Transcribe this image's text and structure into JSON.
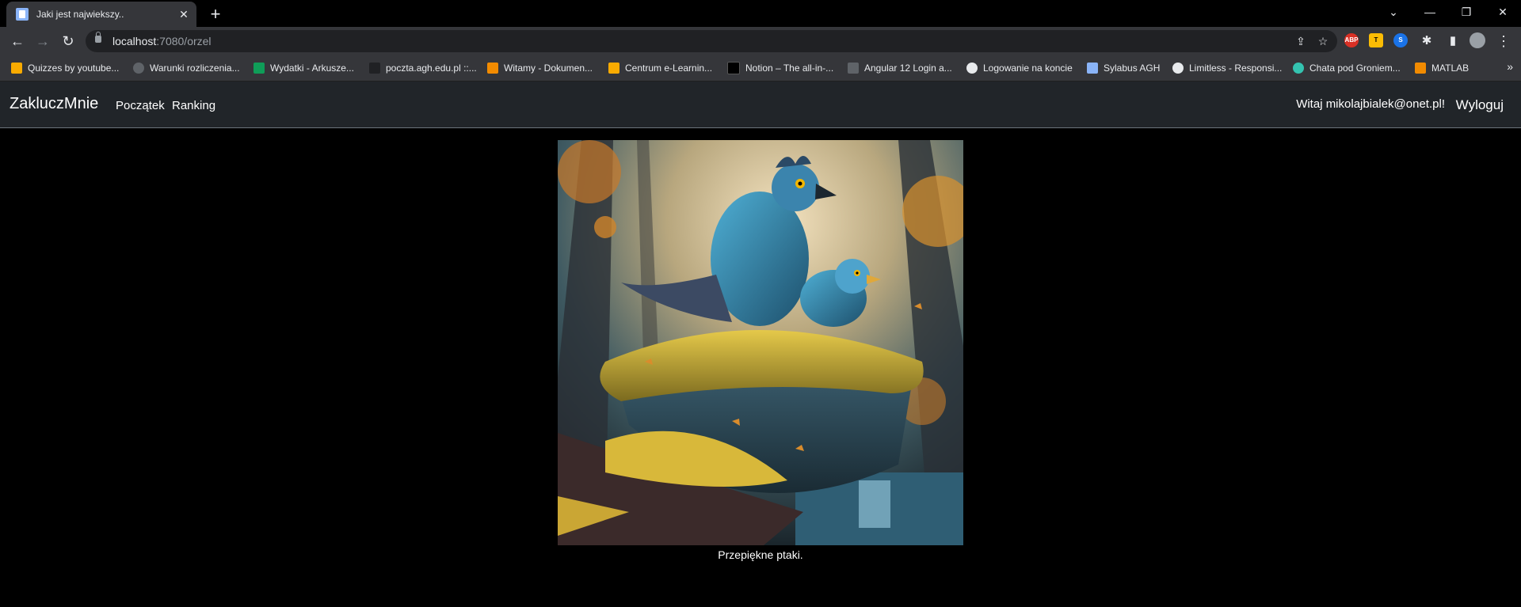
{
  "browser": {
    "tab_title": "Jaki jest najwiekszy..",
    "url_host": "localhost",
    "url_path": ":7080/orzel",
    "bookmarks": [
      {
        "label": "Quizzes by youtube...",
        "color": "#f9ab00"
      },
      {
        "label": "Warunki rozliczenia...",
        "color": "#5f6368"
      },
      {
        "label": "Wydatki - Arkusze...",
        "color": "#0f9d58"
      },
      {
        "label": "poczta.agh.edu.pl ::...",
        "color": "#202124"
      },
      {
        "label": "Witamy - Dokumen...",
        "color": "#f28b00"
      },
      {
        "label": "Centrum e-Learnin...",
        "color": "#f9ab00"
      },
      {
        "label": "Notion – The all-in-...",
        "color": "#000000"
      },
      {
        "label": "Angular 12 Login a...",
        "color": "#5f6368"
      },
      {
        "label": "Logowanie na koncie",
        "color": "#e8eaed"
      },
      {
        "label": "Sylabus AGH",
        "color": "#8ab4f8"
      },
      {
        "label": "Limitless - Responsi...",
        "color": "#e8eaed"
      },
      {
        "label": "Chata pod Groniem...",
        "color": "#34c3b0"
      },
      {
        "label": "MATLAB",
        "color": "#f28b00"
      }
    ],
    "extensions": [
      "ABP",
      "T",
      "S"
    ]
  },
  "app": {
    "brand": "ZakluczMnie",
    "nav": [
      "Początek",
      "Ranking"
    ],
    "greeting": "Witaj mikolajbialek@onet.pl!",
    "logout": "Wyloguj"
  },
  "content": {
    "caption": "Przepiękne ptaki."
  }
}
